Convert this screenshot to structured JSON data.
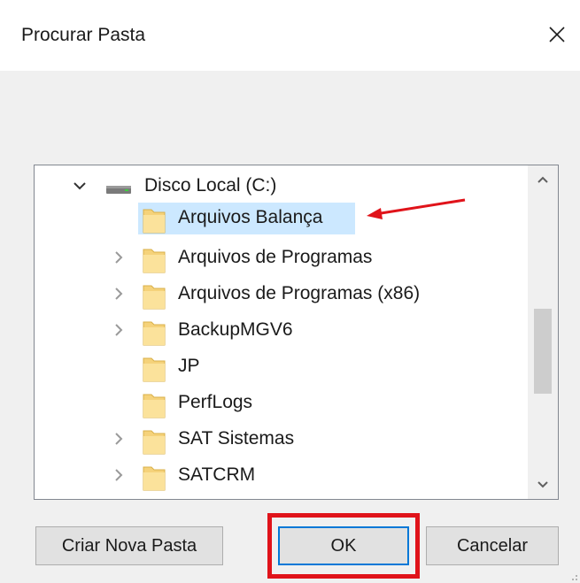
{
  "dialog": {
    "title": "Procurar Pasta",
    "close_icon": "close-icon"
  },
  "tree": {
    "drive": {
      "label": "Disco Local (C:)",
      "expanded": true,
      "icon": "drive-icon"
    },
    "items": [
      {
        "label": "Arquivos Balança",
        "has_children": false,
        "selected": true
      },
      {
        "label": "Arquivos de Programas",
        "has_children": true,
        "selected": false
      },
      {
        "label": "Arquivos de Programas (x86)",
        "has_children": true,
        "selected": false
      },
      {
        "label": "BackupMGV6",
        "has_children": true,
        "selected": false
      },
      {
        "label": "JP",
        "has_children": false,
        "selected": false
      },
      {
        "label": "PerfLogs",
        "has_children": false,
        "selected": false
      },
      {
        "label": "SAT Sistemas",
        "has_children": true,
        "selected": false
      },
      {
        "label": "SATCRM",
        "has_children": true,
        "selected": false
      }
    ]
  },
  "buttons": {
    "create_label": "Criar Nova Pasta",
    "ok_label": "OK",
    "cancel_label": "Cancelar"
  },
  "colors": {
    "selection": "#cce8ff",
    "annotation": "#e0131a",
    "focus": "#0078d7",
    "folder": "#f5d27a"
  }
}
